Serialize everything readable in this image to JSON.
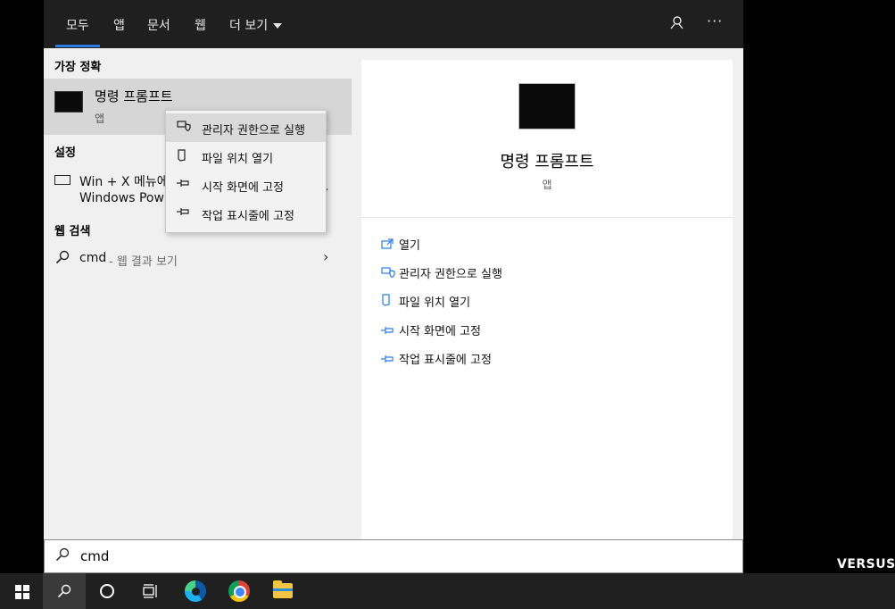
{
  "tabs": [
    "모두",
    "앱",
    "문서",
    "웹",
    "더 보기"
  ],
  "top_icons": [
    "feedback-icon",
    "more-options-icon"
  ],
  "top_more_glyph": "···",
  "sections": {
    "best_match": "가장 정확",
    "settings": "설정",
    "web_search": "웹 검색"
  },
  "best_match_item": {
    "title": "명령 프롬프트",
    "subtitle": "앱"
  },
  "settings_item": {
    "line1": "Win + X 메뉴에",
    "line2": "Windows Pow"
  },
  "web_item": {
    "query": "cmd",
    "suffix": "- 웹 결과 보기"
  },
  "context_menu": [
    {
      "label": "관리자 권한으로 실행",
      "icon": "shield-icon"
    },
    {
      "label": "파일 위치 열기",
      "icon": "file-location-icon"
    },
    {
      "label": "시작 화면에 고정",
      "icon": "pin-icon"
    },
    {
      "label": "작업 표시줄에 고정",
      "icon": "pin-icon"
    }
  ],
  "details": {
    "title": "명령 프롬프트",
    "subtitle": "앱",
    "actions": [
      {
        "label": "열기",
        "icon": "open-icon"
      },
      {
        "label": "관리자 권한으로 실행",
        "icon": "shield-icon"
      },
      {
        "label": "파일 위치 열기",
        "icon": "file-location-icon"
      },
      {
        "label": "시작 화면에 고정",
        "icon": "pin-icon"
      },
      {
        "label": "작업 표시줄에 고정",
        "icon": "pin-icon"
      }
    ]
  },
  "search": {
    "value": "cmd"
  },
  "watermark": "VERSUS.KR",
  "accent_color": "#2a7be4"
}
